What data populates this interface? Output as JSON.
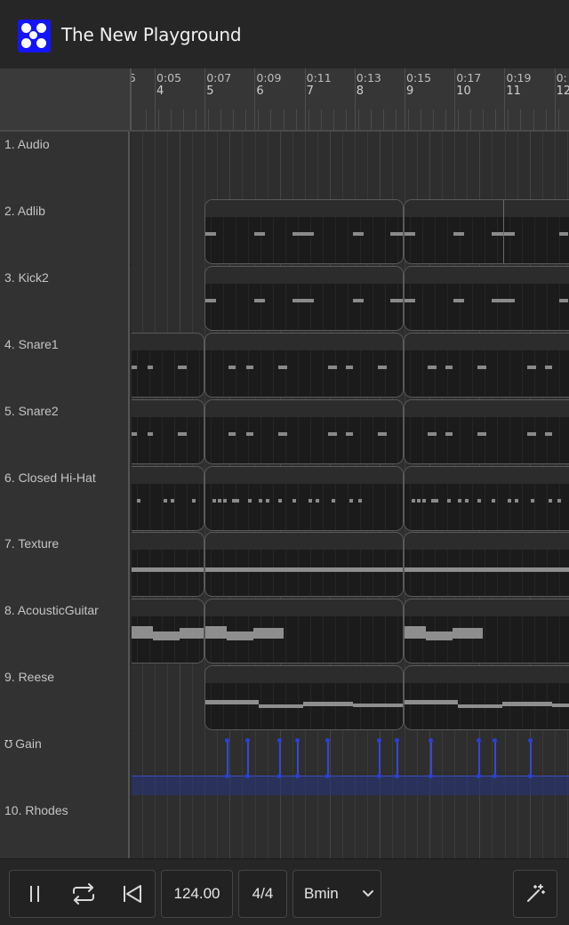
{
  "app": {
    "title": "The New Playground"
  },
  "ruler": {
    "marks": [
      {
        "time": "0:05",
        "bar": "4"
      },
      {
        "time": "0:07",
        "bar": "5"
      },
      {
        "time": "0:09",
        "bar": "6"
      },
      {
        "time": "0:11",
        "bar": "7"
      },
      {
        "time": "0:13",
        "bar": "8"
      },
      {
        "time": "0:15",
        "bar": "9"
      },
      {
        "time": "0:17",
        "bar": "10"
      },
      {
        "time": "0:19",
        "bar": "11"
      },
      {
        "time": "0:",
        "bar": "12"
      }
    ],
    "leading_fragment": "5"
  },
  "tracks": [
    {
      "label": "1. Audio",
      "kind": "empty"
    },
    {
      "label": "2. Adlib",
      "kind": "notes"
    },
    {
      "label": "3. Kick2",
      "kind": "notes"
    },
    {
      "label": "4. Snare1",
      "kind": "notes"
    },
    {
      "label": "5. Snare2",
      "kind": "notes"
    },
    {
      "label": "6. Closed Hi-Hat",
      "kind": "notes"
    },
    {
      "label": "7. Texture",
      "kind": "line"
    },
    {
      "label": "8. AcousticGuitar",
      "kind": "wave"
    },
    {
      "label": "9. Reese",
      "kind": "wave"
    },
    {
      "label": "Gain",
      "kind": "automation",
      "icon": "automation-icon"
    },
    {
      "label": "10. Rhodes",
      "kind": "empty"
    }
  ],
  "transport": {
    "tempo": "124.00",
    "time_signature": "4/4",
    "key": "Bmin"
  },
  "colors": {
    "logo": "#1414ff",
    "automation": "#2a3fdf"
  }
}
